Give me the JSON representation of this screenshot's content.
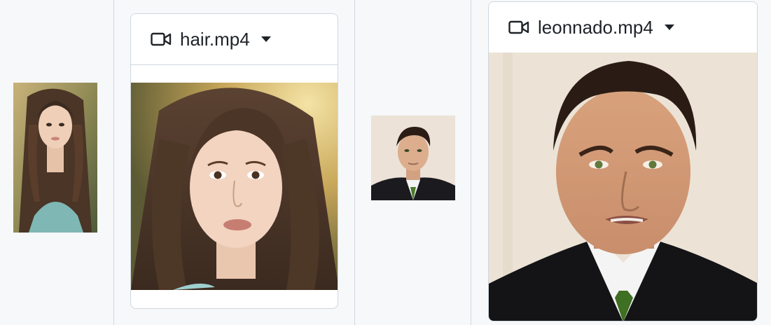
{
  "cards": [
    {
      "file_name": "hair.mp4",
      "icon": "video-camera-icon"
    },
    {
      "file_name": "leonnado.mp4",
      "icon": "video-camera-icon"
    }
  ],
  "colors": {
    "page_bg": "#f6f8fa",
    "border": "#d0d7de",
    "text": "#1f2328"
  }
}
